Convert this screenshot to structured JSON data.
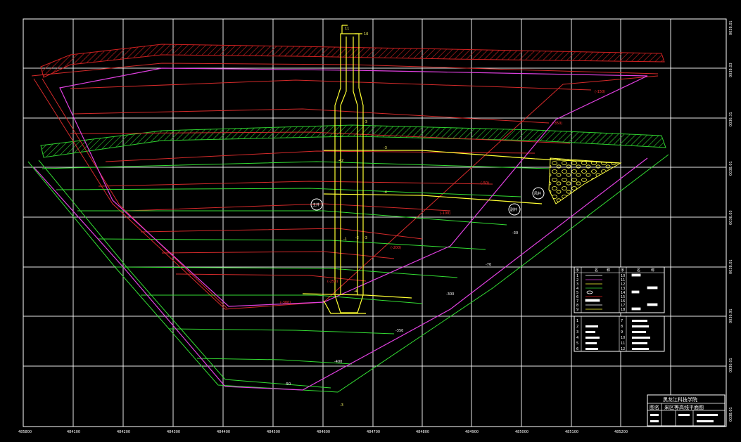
{
  "title_block": {
    "org": "黑龙江科技学院",
    "row_label": "图名",
    "drawing_name": "采区等高线平面图"
  },
  "x_ticks": [
    "485800",
    "484100",
    "484200",
    "484300",
    "484400",
    "484500",
    "484600",
    "484700",
    "484800",
    "484900",
    "485000",
    "485100",
    "485200"
  ],
  "y_ticks": [
    "0038.01",
    "0038.03",
    "0036.31",
    "0038.01",
    "0036.03",
    "0038.01",
    "0036.91",
    "0036.01",
    "0038.01"
  ],
  "contour_labels": {
    "red": [
      "(-150)",
      "(-50)",
      "(-100)",
      "(-200)",
      "(-250)",
      "(-300)",
      "(-350)"
    ],
    "green": [
      "-30",
      "-70",
      "-300",
      "-350",
      "-400",
      "-50"
    ]
  },
  "shaft_labels": [
    "11",
    "10",
    "-3",
    "-42",
    "-3",
    "-4",
    "-2",
    "-1",
    "-3",
    "-4",
    "-3"
  ],
  "symbols": [
    "主井",
    "副井",
    "风井"
  ],
  "legend_rows": [
    "1",
    "2",
    "3",
    "4",
    "5",
    "6",
    "7",
    "8",
    "9"
  ],
  "legend_rows_b": [
    "10",
    "11",
    "12",
    "13",
    "14",
    "15",
    "16",
    "17",
    "18"
  ],
  "legend2_rows": [
    "1",
    "2",
    "3",
    "4",
    "5",
    "6"
  ],
  "legend2_rows_b": [
    "7",
    "8",
    "9",
    "10",
    "11",
    "12"
  ],
  "legend_header": [
    "序",
    "名",
    "称",
    "序",
    "名",
    "称"
  ],
  "colors": {
    "background": "#000000",
    "grid": "#ffffff",
    "red_seam": "#e02020",
    "green_seam": "#33dd33",
    "magenta_boundary": "#e040e0",
    "shaft": "#ffff33"
  }
}
